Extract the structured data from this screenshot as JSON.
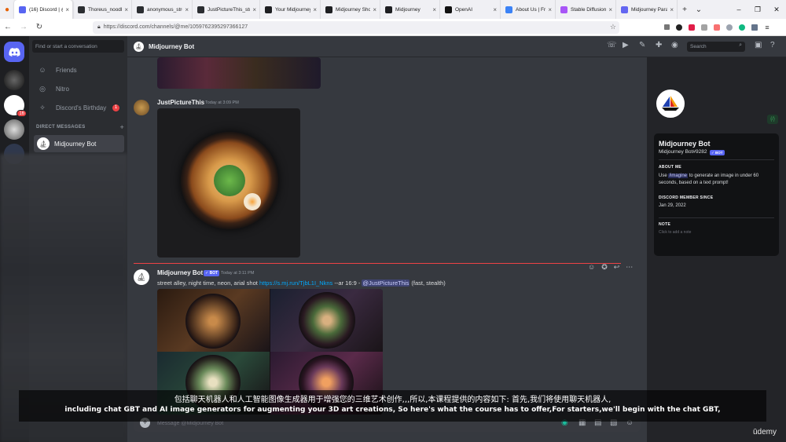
{
  "browser": {
    "tabs": [
      {
        "title": "(16) Discord | @",
        "active": true,
        "color": "#5865f2"
      },
      {
        "title": "Thoreus_noodle_bo",
        "active": false,
        "color": "#2b2d31"
      },
      {
        "title": "anonymous_street_a",
        "active": false,
        "color": "#2b2d31"
      },
      {
        "title": "JustPictureThis_stree",
        "active": false,
        "color": "#2b2d31"
      },
      {
        "title": "Your Midjourney",
        "active": false,
        "color": "#1e1f22"
      },
      {
        "title": "Midjourney Sho",
        "active": false,
        "color": "#1e1f22"
      },
      {
        "title": "Midjourney",
        "active": false,
        "color": "#1e1f22"
      },
      {
        "title": "OpenAI",
        "active": false,
        "color": "#111111"
      },
      {
        "title": "About Us | Freep",
        "active": false,
        "color": "#3b82f6"
      },
      {
        "title": "Stable Diffusion",
        "active": false,
        "color": "#a855f7"
      },
      {
        "title": "Midjourney Para",
        "active": false,
        "color": "#6366f1"
      }
    ],
    "tab_close": "×",
    "new_tab": "+",
    "tab_list": "⌄",
    "window_controls": [
      "–",
      "❐",
      "✕"
    ],
    "url": "https://discord.com/channels/@me/1059762395297366127",
    "nav": {
      "back": "←",
      "forward": "→",
      "reload": "↻"
    }
  },
  "discord": {
    "dm_search_placeholder": "Find or start a conversation",
    "nav_items": [
      {
        "label": "Friends",
        "icon": "friends-icon",
        "glyph": "☺"
      },
      {
        "label": "Nitro",
        "icon": "nitro-icon",
        "glyph": "◎"
      },
      {
        "label": "Discord's Birthday",
        "icon": "birthday-icon",
        "glyph": "✧",
        "count": "1"
      }
    ],
    "dm_header": "DIRECT MESSAGES",
    "dm_add": "+",
    "active_dm": "Midjourney Bot",
    "guild_badge": "16",
    "chat_title": "Midjourney Bot",
    "search_placeholder": "Search",
    "messages": [
      {
        "author": "JustPictureThis",
        "time": "Today at 3:09 PM"
      },
      {
        "author": "Midjourney Bot",
        "bot_tag": "✓ BOT",
        "time": "Today at 3:11 PM",
        "prompt": "street alley, night time, neon, arial shot ",
        "link": "https://s.mj.run/TjbL1I_Nkns",
        "params": " --ar 16:9 - ",
        "mention": "@JustPictureThis",
        "suffix": " (fast, stealth)"
      }
    ],
    "input_placeholder": "Message @Midjourney Bot",
    "profile": {
      "name": "Midjourney Bot",
      "tag": "Midjourney Bot#9282",
      "bot_tag": "✓ BOT",
      "code_badge": "{/}",
      "about_head": "ABOUT ME",
      "about_pre": "Use ",
      "about_cmd": "/imagine",
      "about_post": " to generate an image in under 60 seconds, based on a text prompt!",
      "since_head": "DISCORD MEMBER SINCE",
      "since": "Jan 29, 2022",
      "note_head": "NOTE",
      "note_placeholder": "Click to add a note"
    }
  },
  "subtitles": {
    "zh": "包括聊天机器人和人工智能图像生成器用于增强您的三维艺术创作,,,所以,本课程提供的内容如下: 首先,我们将使用聊天机器人,",
    "en": "including chat GBT and AI image generators for augmenting your 3D art creations, So here's what the course has to offer,For starters,we'll begin with the chat GBT,"
  },
  "watermark": "ūdemy"
}
